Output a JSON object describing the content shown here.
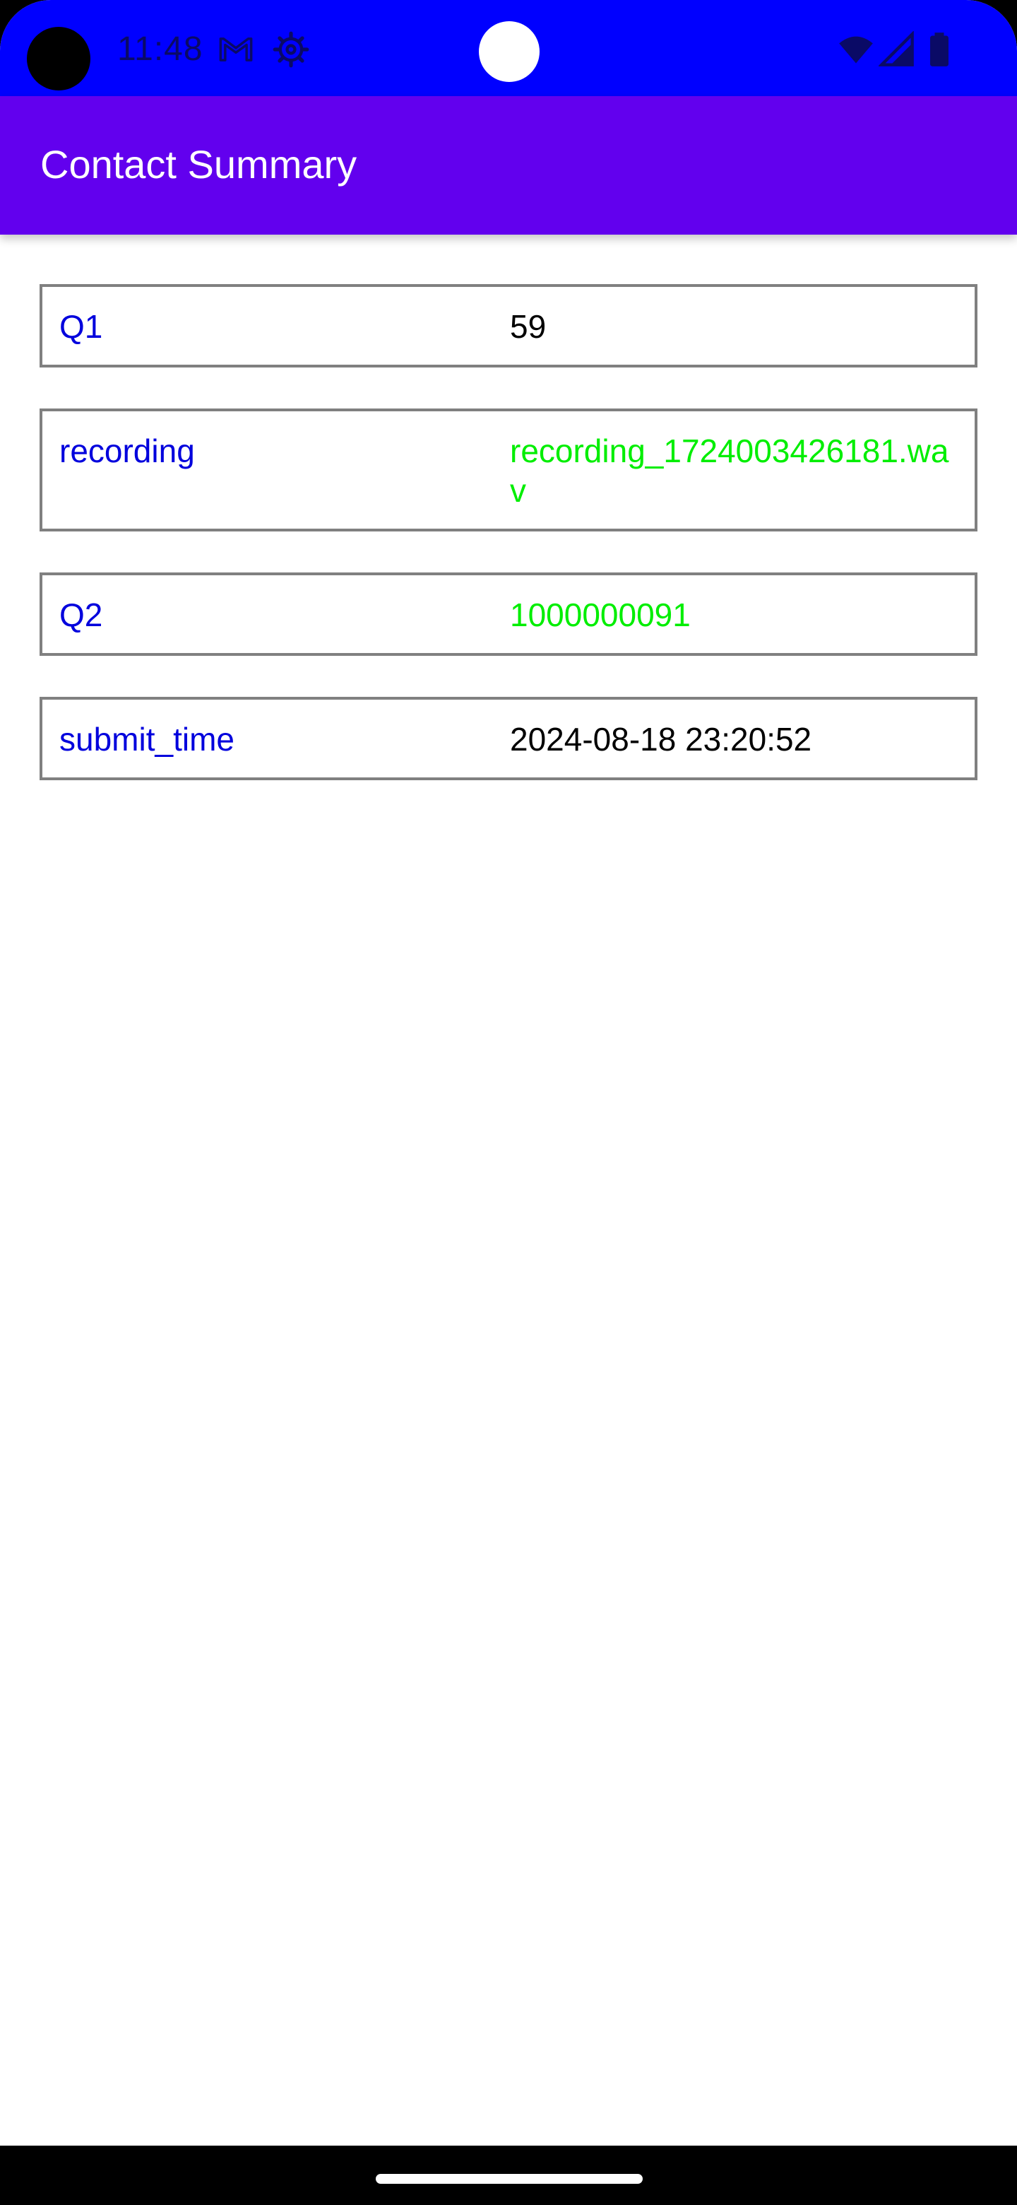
{
  "status_bar": {
    "time": "11:48",
    "icons_left": [
      "gmail-icon",
      "settings-icon"
    ],
    "icons_right": [
      "wifi-icon",
      "cell-signal-icon",
      "battery-icon"
    ],
    "color": "#0000ff"
  },
  "app_bar": {
    "title": "Contact Summary",
    "color": "#6200ee"
  },
  "rows": [
    {
      "key": "Q1",
      "value": "59",
      "value_color": "#000000"
    },
    {
      "key": "recording",
      "value": "recording_1724003426181.wav",
      "value_color": "#00ee00"
    },
    {
      "key": "Q2",
      "value": "1000000091",
      "value_color": "#00ee00"
    },
    {
      "key": "submit_time",
      "value": "2024-08-18 23:20:52",
      "value_color": "#000000"
    }
  ],
  "colors": {
    "key_text": "#0000dd",
    "row_border": "#808080"
  }
}
